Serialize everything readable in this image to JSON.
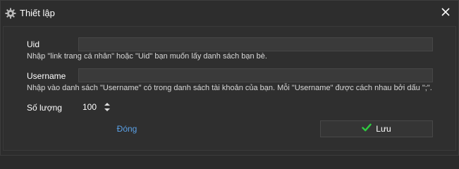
{
  "window": {
    "title": "Thiết lập",
    "icon": "gear-icon",
    "close_icon": "close-icon"
  },
  "form": {
    "uid_label": "Uid",
    "uid_value": "",
    "uid_hint": "Nhập \"link trang cá nhân\" hoặc \"Uid\" bạn muốn lấy danh sách bạn bè.",
    "username_label": "Username",
    "username_value": "",
    "username_hint": "Nhập vào danh sách \"Username\" có trong danh sách tài khoản của bạn. Mỗi \"Username\" được cách nhau bởi dấu \";\".",
    "quantity_label": "Số lượng",
    "quantity_value": "100"
  },
  "actions": {
    "close_label": "Đóng",
    "save_label": "Lưu",
    "save_icon": "checkmark-icon"
  },
  "colors": {
    "accent_link": "#5aa0e6",
    "check_green": "#2ecc40",
    "background": "#2d2d2d"
  }
}
